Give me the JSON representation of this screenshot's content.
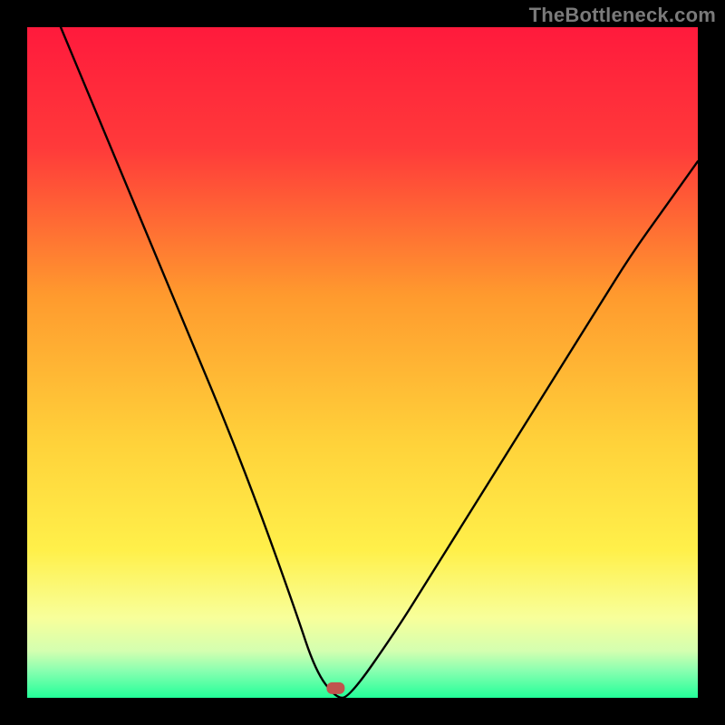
{
  "watermark": "TheBottleneck.com",
  "chart_data": {
    "type": "line",
    "title": "",
    "xlabel": "",
    "ylabel": "",
    "xlim": [
      0,
      100
    ],
    "ylim": [
      0,
      100
    ],
    "comment": "V-shaped curve over a vertical rainbow gradient. The curve approaches y≈0 (bottom/green) near x≈46 where a small red marker sits, and rises toward the top (red) at the x extremes. Values below are visual estimates (percent of plot area).",
    "x": [
      5,
      10,
      15,
      20,
      25,
      30,
      35,
      40,
      43,
      46,
      48,
      55,
      60,
      65,
      70,
      75,
      80,
      85,
      90,
      95,
      100
    ],
    "values": [
      100,
      88,
      76,
      64,
      52,
      40,
      27,
      13,
      4,
      0,
      0,
      10,
      18,
      26,
      34,
      42,
      50,
      58,
      66,
      73,
      80
    ],
    "marker": {
      "x": 46,
      "y": 1.5
    },
    "gradient_bands_note": "Background is a smooth vertical gradient red→orange→yellow→pale-yellow→green (top→bottom) inside a black frame."
  }
}
